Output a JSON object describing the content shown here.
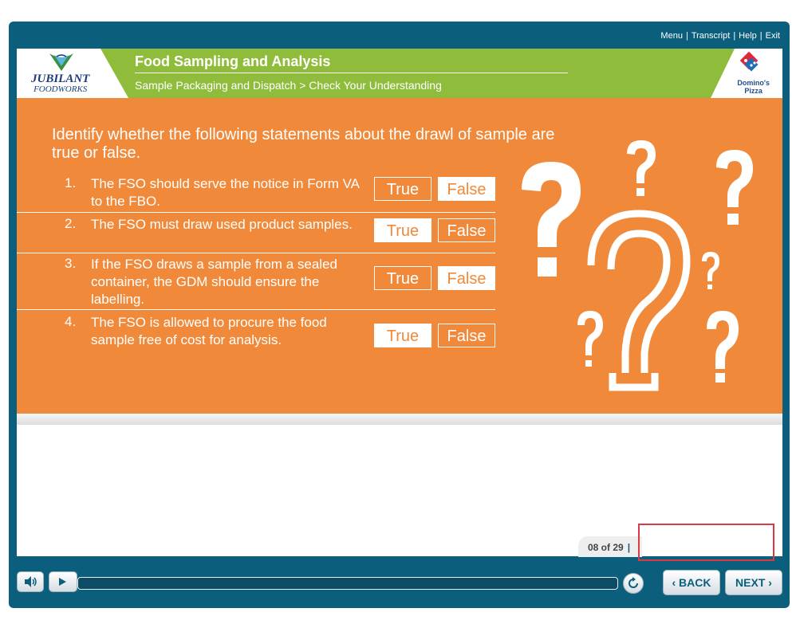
{
  "topnav": {
    "menu": "Menu",
    "transcript": "Transcript",
    "help": "Help",
    "exit": "Exit",
    "sep": "|"
  },
  "header": {
    "logo_left_line1": "JUBILANT",
    "logo_left_line2": "FOODWORKS",
    "course_title": "Food Sampling and Analysis",
    "breadcrumb": "Sample Packaging and Dispatch > Check Your Understanding",
    "logo_right_line1": "Domino's",
    "logo_right_line2": "Pizza"
  },
  "question": {
    "instruction": "Identify whether the following statements about the drawl of sample are true or false.",
    "items": [
      {
        "num": "1.",
        "text": "The FSO should serve the notice in Form VA to the FBO.",
        "true_label": "True",
        "false_label": "False",
        "selected": "False"
      },
      {
        "num": "2.",
        "text": "The FSO must draw used product samples.",
        "true_label": "True",
        "false_label": "False",
        "selected": "True"
      },
      {
        "num": "3.",
        "text": "If the FSO draws a sample from a sealed container, the GDM should ensure the labelling.",
        "true_label": "True",
        "false_label": "False",
        "selected": "False"
      },
      {
        "num": "4.",
        "text": "The FSO is allowed to procure the food sample free of cost for analysis.",
        "true_label": "True",
        "false_label": "False",
        "selected": "True"
      }
    ]
  },
  "footer": {
    "page_count": "08 of 29",
    "page_sep": "|"
  },
  "controls": {
    "back_label": "‹ BACK",
    "next_label": "NEXT ›"
  },
  "icons": {
    "audio": "speaker-icon",
    "play": "play-icon",
    "replay": "replay-icon",
    "decor": "question-marks-graphic",
    "emblem": "jubilant-emblem",
    "dominos": "dominos-logo"
  },
  "colors": {
    "frame": "#0c5f7c",
    "header_green": "#8fbd3b",
    "content_orange": "#f08a3a",
    "highlight_red": "#d93a45"
  }
}
